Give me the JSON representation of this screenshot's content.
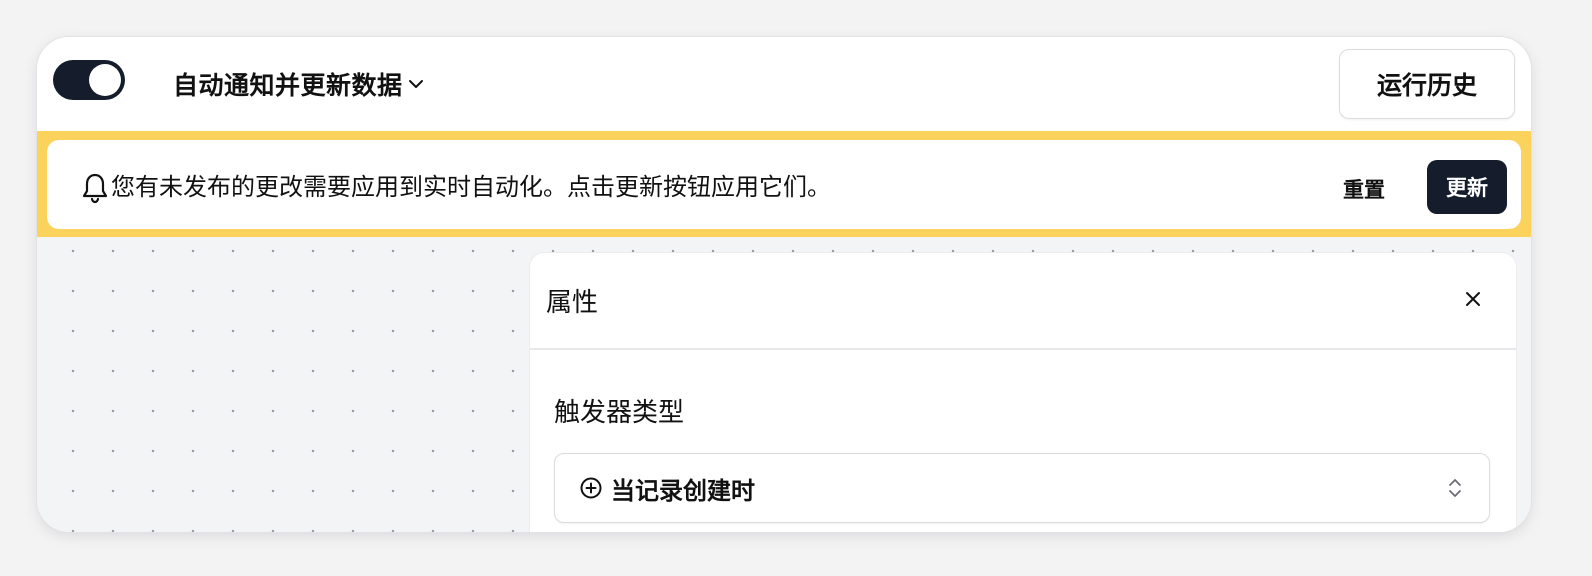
{
  "header": {
    "toggle_on": true,
    "workflow_title": "自动通知并更新数据",
    "history_button_label": "运行历史"
  },
  "banner": {
    "icon": "bell-icon",
    "message": "您有未发布的更改需要应用到实时自动化。点击更新按钮应用它们。",
    "reset_label": "重置",
    "update_label": "更新",
    "accent_color": "#fbd35c"
  },
  "panel": {
    "title": "属性",
    "close_icon": "close-icon",
    "trigger_type_label": "触发器类型",
    "trigger_select": {
      "icon": "plus-circle-icon",
      "value": "当记录创建时",
      "indicator_icon": "chevron-up-down-icon"
    }
  },
  "colors": {
    "primary_dark": "#151c2b",
    "canvas_bg": "#f3f4f6"
  }
}
